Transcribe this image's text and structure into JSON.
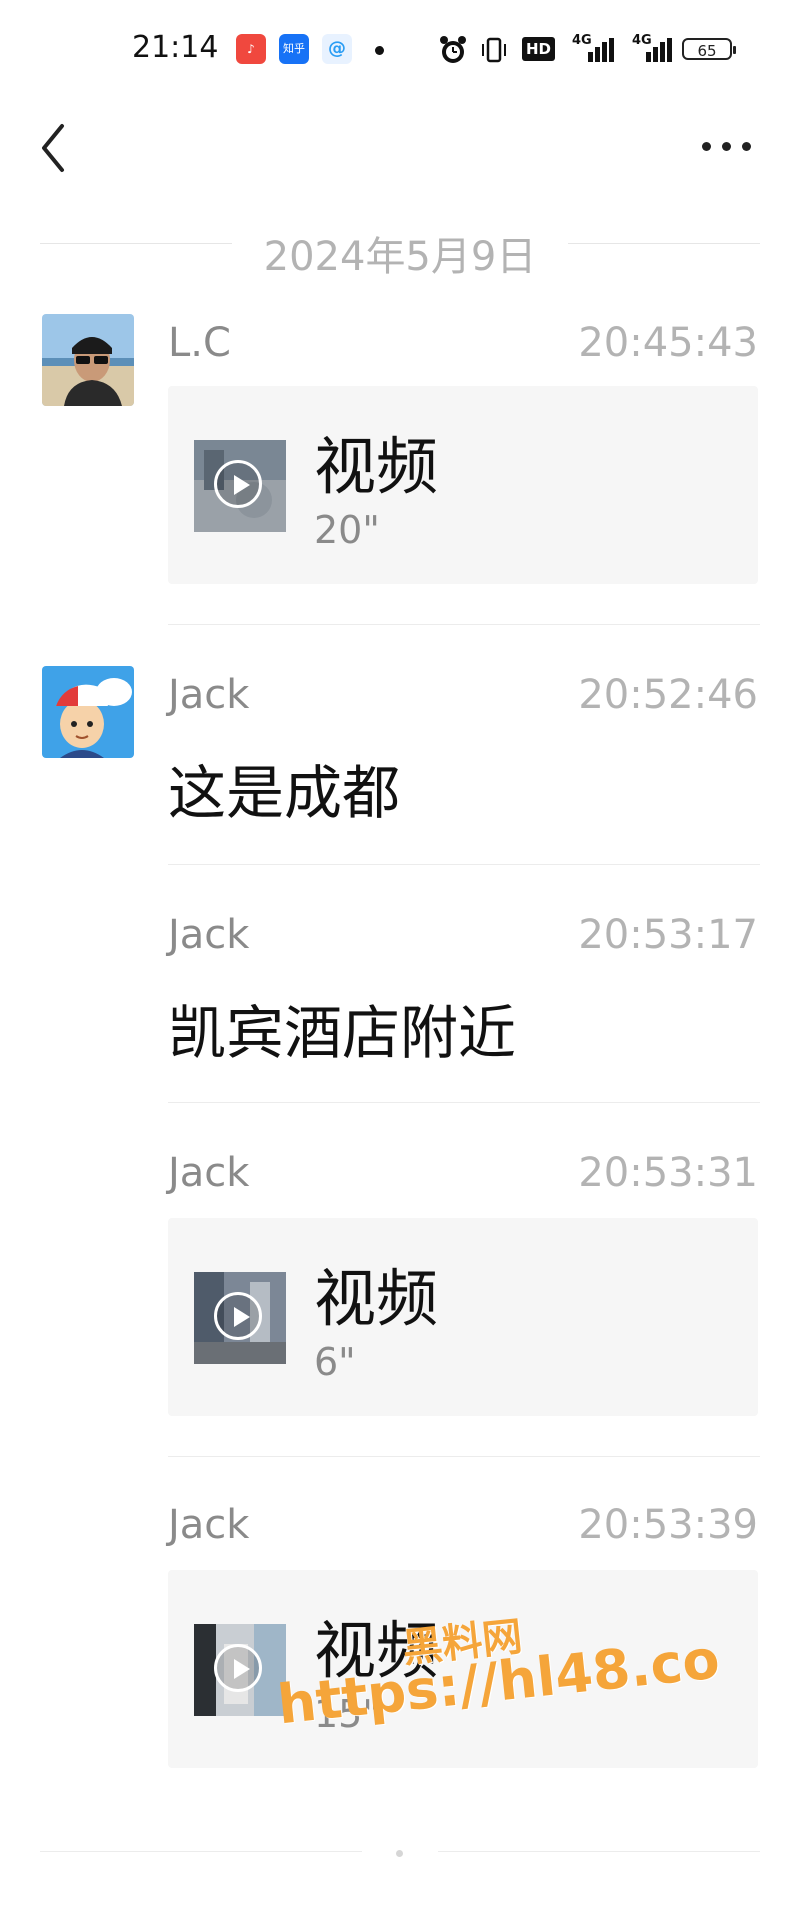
{
  "status_bar": {
    "time": "21:14",
    "app_icons": [
      {
        "name": "music-app-icon",
        "text": "♪",
        "color": "#f0483e"
      },
      {
        "name": "zhihu-app-icon",
        "text": "知乎",
        "color": "#1772f6"
      },
      {
        "name": "browser-app-icon",
        "text": "@",
        "color": "#2a9df4"
      }
    ],
    "hd_label": "HD",
    "net1": "4G",
    "net2": "4G",
    "battery": "65"
  },
  "header": {
    "back_icon": "chevron-left-icon",
    "more_icon": "more-dots-icon"
  },
  "date_separator": "2024年5月9日",
  "messages": [
    {
      "sender": "L.C",
      "time": "20:45:43",
      "type": "video",
      "label": "视频",
      "duration": "20\""
    },
    {
      "sender": "Jack",
      "time": "20:52:46",
      "type": "text",
      "text": "这是成都"
    },
    {
      "sender": "Jack",
      "time": "20:53:17",
      "type": "text",
      "text": "凯宾酒店附近"
    },
    {
      "sender": "Jack",
      "time": "20:53:31",
      "type": "video",
      "label": "视频",
      "duration": "6\""
    },
    {
      "sender": "Jack",
      "time": "20:53:39",
      "type": "video",
      "label": "视频",
      "duration": "15\""
    }
  ],
  "watermark": {
    "line1": "黑料网",
    "line2": "https://hl48.co"
  }
}
